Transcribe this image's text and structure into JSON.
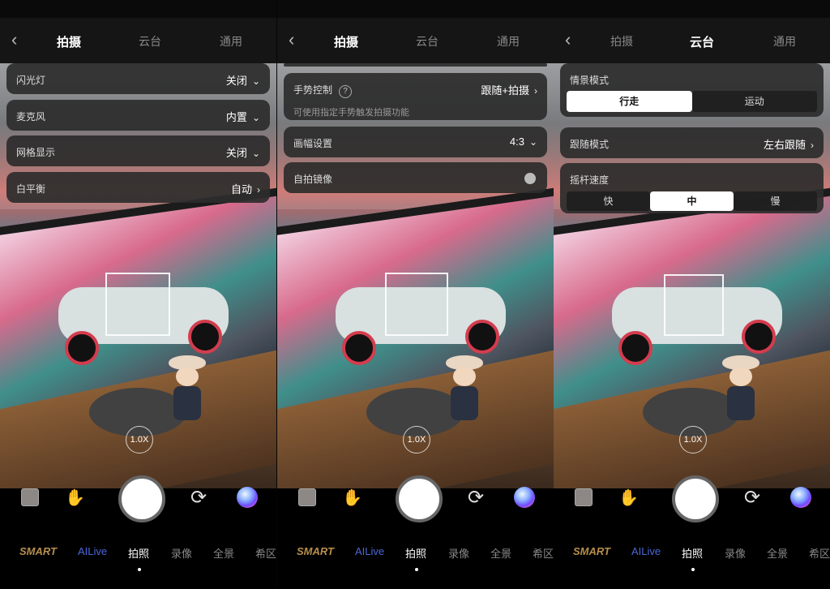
{
  "screens": [
    {
      "header": {
        "back": "‹",
        "tabs": [
          "拍摄",
          "云台",
          "通用"
        ],
        "active_tab": 0
      },
      "rows": [
        {
          "label": "闪光灯",
          "value": "关闭"
        },
        {
          "label": "麦克风",
          "value": "内置"
        },
        {
          "label": "网格显示",
          "value": "关闭"
        },
        {
          "label": "白平衡",
          "value": "自动"
        }
      ],
      "zoom": "1.0X",
      "modes": [
        "SMART",
        "AILive",
        "拍照",
        "录像",
        "全景",
        "希区"
      ]
    },
    {
      "header": {
        "back": "‹",
        "tabs": [
          "拍摄",
          "云台",
          "通用"
        ],
        "active_tab": 0
      },
      "gesture": {
        "label": "手势控制",
        "value": "跟随+拍摄",
        "desc": "可使用指定手势触发拍摄功能"
      },
      "rows": [
        {
          "label": "画幅设置",
          "value": "4:3"
        },
        {
          "label": "自拍镜像",
          "value": ""
        }
      ],
      "zoom": "1.0X",
      "modes": [
        "SMART",
        "AILive",
        "拍照",
        "录像",
        "全景",
        "希区"
      ]
    },
    {
      "header": {
        "back": "‹",
        "tabs": [
          "拍摄",
          "云台",
          "通用"
        ],
        "active_tab": 1
      },
      "scene_mode": {
        "label": "情景模式",
        "options": [
          "行走",
          "运动"
        ],
        "active": 0
      },
      "follow_mode": {
        "label": "跟随模式",
        "value": "左右跟随"
      },
      "joystick_speed": {
        "label": "摇杆速度",
        "options": [
          "快",
          "中",
          "慢"
        ],
        "active": 1
      },
      "zoom": "1.0X",
      "modes": [
        "SMART",
        "AILive",
        "拍照",
        "录像",
        "全景",
        "希区"
      ]
    }
  ],
  "icons": [
    "back-icon",
    "chevron-down-icon",
    "chevron-right-icon",
    "help-icon",
    "gesture-off-icon",
    "camera-switch-icon",
    "ai-icon",
    "thumbnail-icon"
  ]
}
